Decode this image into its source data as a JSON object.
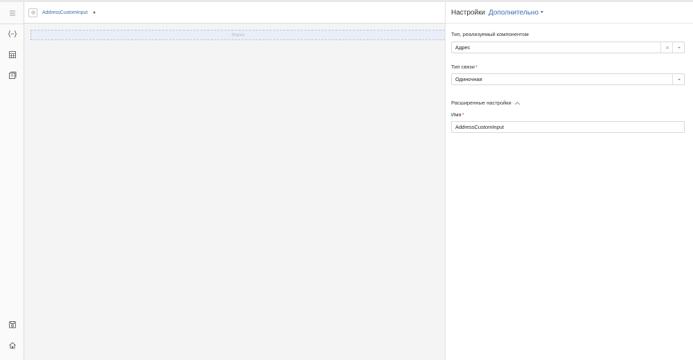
{
  "header": {
    "breadcrumb": "AddressCustomInput"
  },
  "canvas": {
    "form_placeholder": "Форма"
  },
  "rail": {
    "icons": [
      "menu-icon",
      "code-braces-icon",
      "table-icon",
      "list-icon",
      "save-icon",
      "home-icon"
    ]
  },
  "panel": {
    "title": "Настройки",
    "tab": "Дополнительно",
    "component_type": {
      "label": "Тип, реализуемый компонентом",
      "value": "Адрес"
    },
    "link_type": {
      "label": "Тип связи",
      "value": "Одиночная",
      "required": "*"
    },
    "advanced": {
      "label": "Расширенные настройки"
    },
    "name": {
      "label": "Имя",
      "value": "AddressCustomInput",
      "required": "*"
    }
  },
  "colors": {
    "accent": "#3a6bb0",
    "required": "#dd3333",
    "canvas": "#f4f4f4",
    "drop_zone": "#eaeef8"
  }
}
